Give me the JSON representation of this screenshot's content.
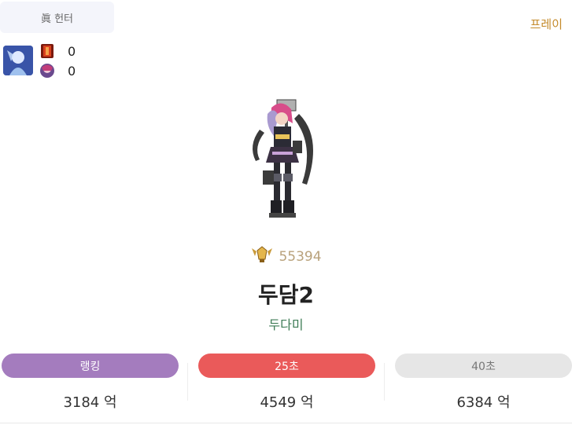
{
  "header": {
    "class_label": "眞 헌터",
    "play_label": "프레이"
  },
  "stats": {
    "row1_value": "0",
    "row2_value": "0"
  },
  "character": {
    "fame_value": "55394",
    "name": "두담2",
    "guild": "두다미"
  },
  "tabs": [
    {
      "label": "랭킹",
      "value": "3184 억"
    },
    {
      "label": "25초",
      "value": "4549 억"
    },
    {
      "label": "40초",
      "value": "6384 억"
    }
  ],
  "colors": {
    "ranking": "#a47cbe",
    "sec25": "#ea5a5a",
    "sec40": "#e6e6e6",
    "play": "#c48a2a",
    "guild": "#3d7b55",
    "fame": "#b9a27c"
  }
}
